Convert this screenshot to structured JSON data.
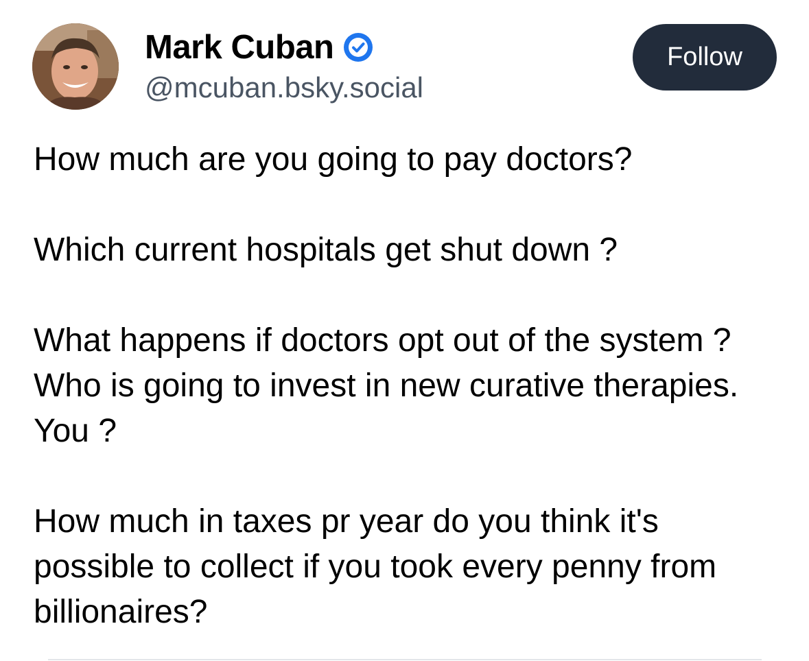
{
  "post": {
    "author": {
      "display_name": "Mark Cuban",
      "handle": "@mcuban.bsky.social",
      "verified": true,
      "verified_icon": "verified-check-icon",
      "avatar": "avatar-photo"
    },
    "follow_button": {
      "label": "Follow"
    },
    "paragraphs": [
      "How much are you going to pay doctors?",
      "Which current hospitals get shut down ?",
      "What happens if doctors opt out of the system ? Who is going to invest in new curative therapies.  You ?",
      "How much in taxes pr year do you think it's possible to collect if you took every penny from billionaires?"
    ]
  },
  "colors": {
    "verified_badge": "#1f76ee",
    "follow_button_bg": "#222c3b",
    "handle_text": "#4a5563"
  }
}
